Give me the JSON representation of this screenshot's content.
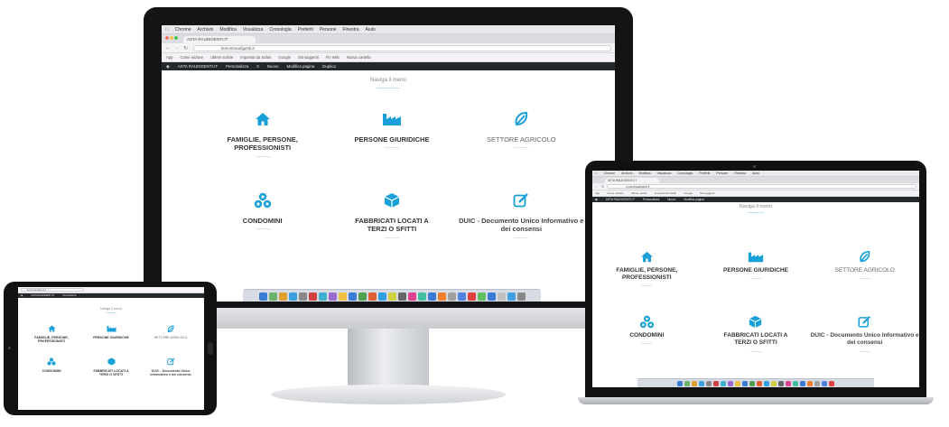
{
  "browser": {
    "menubar": [
      "Chrome",
      "Archivio",
      "Modifica",
      "Visualizza",
      "Cronologia",
      "Preferiti",
      "Persone",
      "Finestra",
      "Aiuto"
    ],
    "tab_title": "ASTA RAUDIGENTI.IT",
    "url": "lemontraudigenti.it",
    "bookmarks": [
      "App",
      "Come iniziare",
      "Ultime notizie",
      "Importati da Safari",
      "Google",
      "Siti suggeriti",
      "Fin Wiki",
      "Nuova cartella"
    ],
    "wp_admin": [
      "ASTA RAUDIGENTI.IT",
      "Personalizza",
      "0",
      "Nuovo",
      "Modifica pagina",
      "Duplica"
    ]
  },
  "page": {
    "nav_title": "Naviga il menù"
  },
  "items": [
    {
      "label": "FAMIGLIE, PERSONE, PROFESSIONISTI",
      "icon": "house-icon",
      "style": "bold"
    },
    {
      "label": "PERSONE GIURIDICHE",
      "icon": "factory-icon",
      "style": "bold"
    },
    {
      "label": "SETTORE AGRICOLO",
      "icon": "leaf-icon",
      "style": "light"
    },
    {
      "label": "CONDOMINI",
      "icon": "cubes-icon",
      "style": "bold"
    },
    {
      "label": "FABBRICATI LOCATI A TERZI O SFITTI",
      "icon": "cube-icon",
      "style": "bold"
    },
    {
      "label": "DUIC - Documento Unico Informativo e dei consensi",
      "icon": "edit-icon",
      "style": "mid"
    }
  ],
  "colors": {
    "accent": "#1aa0d8",
    "wp_bar": "#23282d",
    "text": "#333333"
  }
}
